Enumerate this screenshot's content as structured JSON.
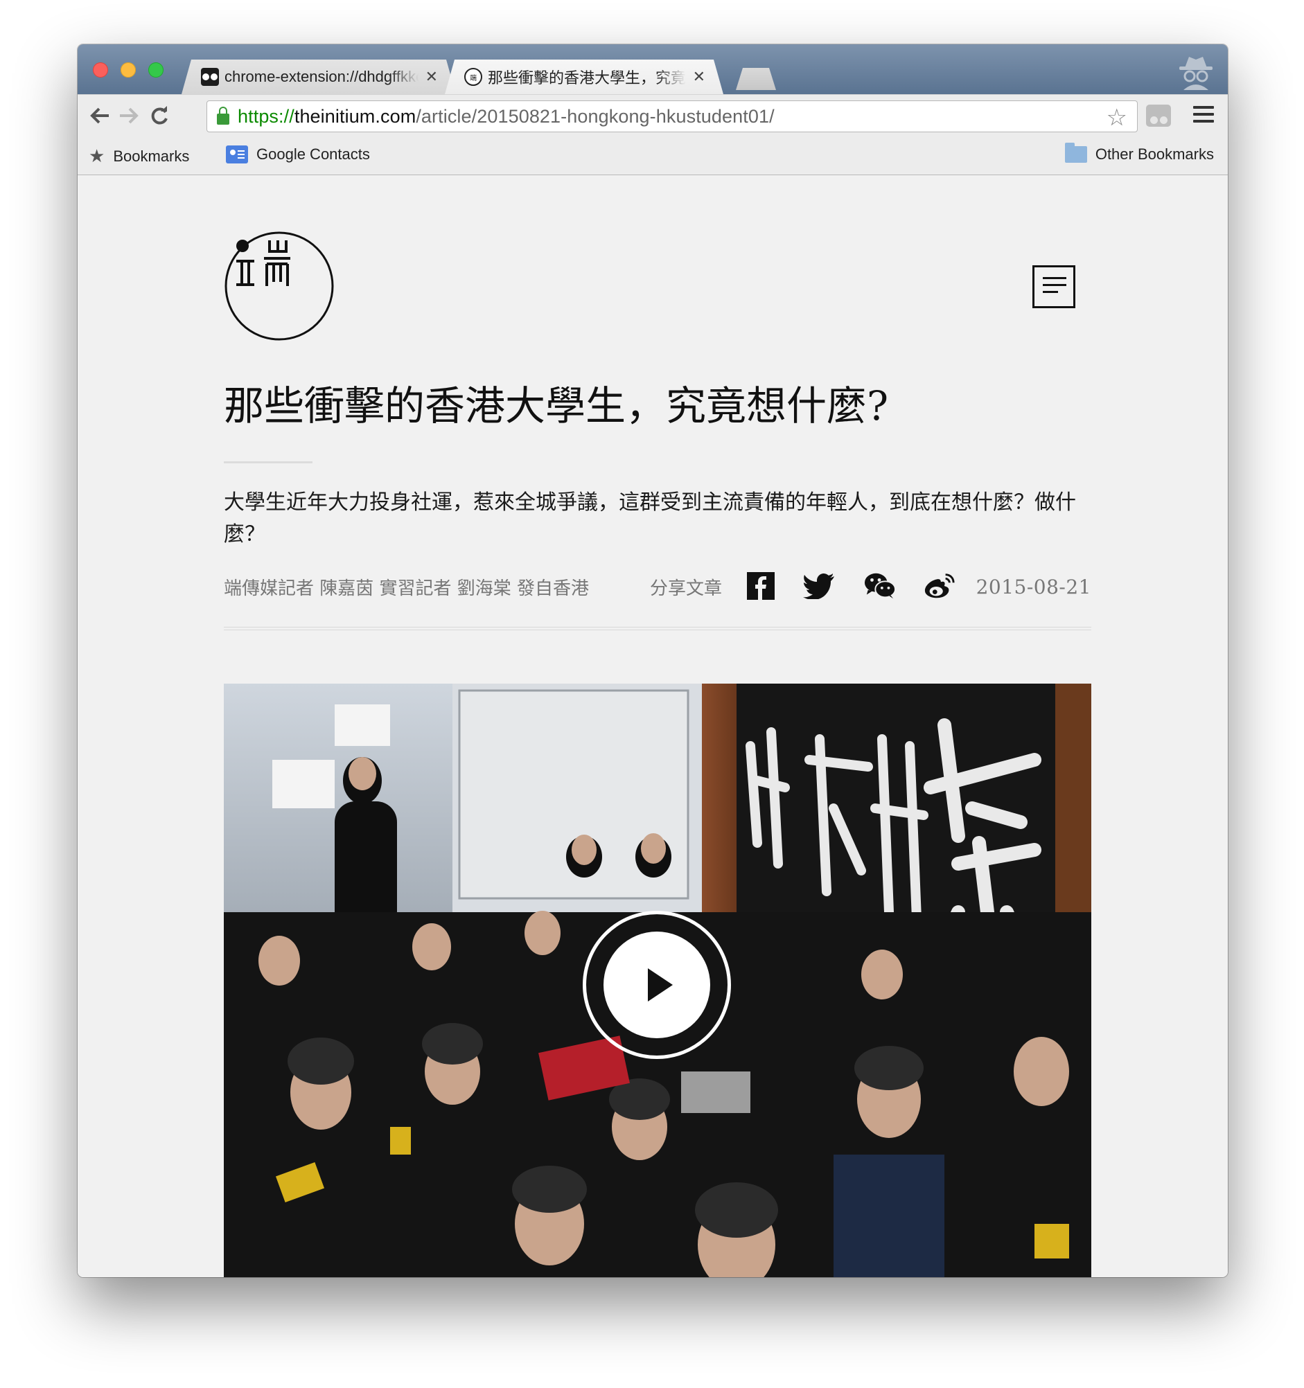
{
  "browser": {
    "tabs": [
      {
        "title": "chrome-extension://dhdgffkkebhmkfjojejmpbldmpobfkfo/",
        "active": false,
        "favicon": "extension-icon"
      },
      {
        "title": "那些衝擊的香港大學生，究竟想什麼？",
        "active": true,
        "favicon": "initium-icon"
      }
    ],
    "url": {
      "scheme": "https://",
      "host": "theinitium.com",
      "path": "/article/20150821-hongkong-hkustudent01/"
    },
    "bookmarks_bar": {
      "bookmarks": "Bookmarks",
      "google_contacts": "Google Contacts",
      "other_bookmarks": "Other Bookmarks"
    }
  },
  "article": {
    "headline": "那些衝擊的香港大學生，究竟想什麼?",
    "summary": "大學生近年大力投身社運，惹來全城爭議，這群受到主流責備的年輕人，到底在想什麼？做什麼？",
    "byline": "端傳媒記者 陳嘉茵 實習記者 劉海棠 發自香港",
    "share_label": "分享文章",
    "date": "2015-08-21",
    "share_icons": [
      "facebook-icon",
      "twitter-icon",
      "wechat-icon",
      "weibo-icon"
    ]
  },
  "colors": {
    "tabstrip": "#6a819c",
    "page_background": "#f1f1f1",
    "url_scheme": "#0b8a00"
  }
}
